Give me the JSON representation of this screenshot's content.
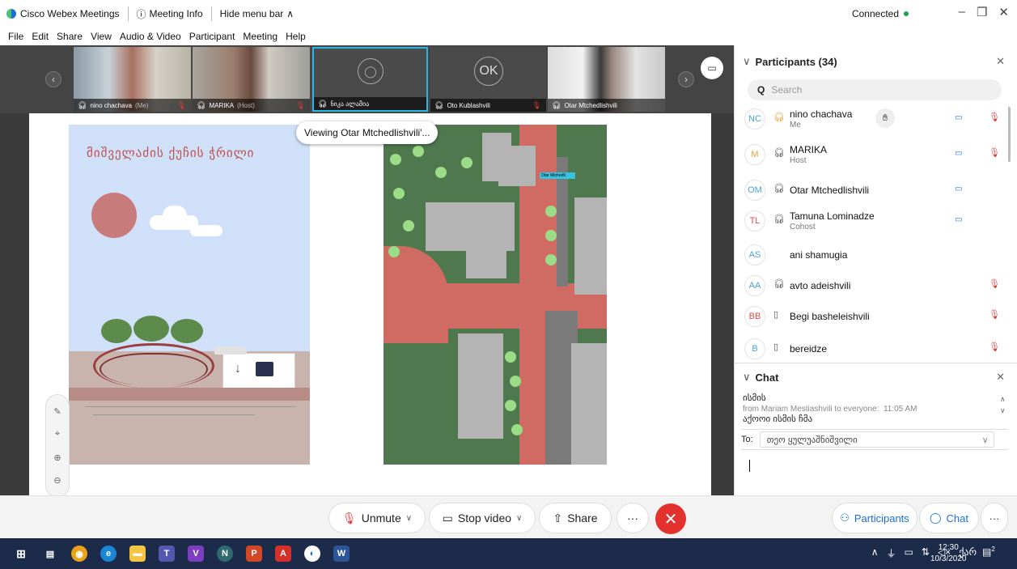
{
  "titlebar": {
    "app_name": "Cisco Webex Meetings",
    "meeting_info": "Meeting Info",
    "hide_menu": "Hide menu bar",
    "status": "Connected",
    "status_color": "#1aa351"
  },
  "menu": [
    "File",
    "Edit",
    "Share",
    "View",
    "Audio & Video",
    "Participant",
    "Meeting",
    "Help"
  ],
  "thumbnails": [
    {
      "name": "nino chachava",
      "tag": "(Me)",
      "muted": true
    },
    {
      "name": "MARIKA",
      "tag": "(Host)",
      "muted": true
    },
    {
      "name": "ნიკა ალამია",
      "tag": "",
      "muted": false
    },
    {
      "name": "Oto Kublashvili",
      "tag": "",
      "muted": true,
      "initials": "OK"
    },
    {
      "name": "Otar Mtchedlishvili",
      "tag": "",
      "muted": false
    }
  ],
  "viewing_label": "Viewing Otar Mtchedlishvili'...",
  "poster_title": "მიშველაძის ქუჩის ჭრილი",
  "map_tag": "Otar Mtchedli",
  "controls": {
    "unmute": "Unmute",
    "stop_video": "Stop video",
    "share": "Share",
    "more": "···",
    "participants": "Participants",
    "chat": "Chat"
  },
  "participants_panel": {
    "title": "Participants (34)",
    "search_placeholder": "Search",
    "list": [
      {
        "initials": "NC",
        "name": "nino chachava",
        "sub": "Me",
        "initials_color": "#4aa3d8",
        "video": true,
        "muted": true
      },
      {
        "initials": "M",
        "name": "MARIKA",
        "sub": "Host",
        "initials_color": "#e9a13b",
        "video": true,
        "muted": true
      },
      {
        "initials": "OM",
        "name": "Otar Mtchedlishvili",
        "sub": "",
        "initials_color": "#4aa3d8",
        "video": true,
        "muted": false
      },
      {
        "initials": "TL",
        "name": "Tamuna Lominadze",
        "sub": "Cohost",
        "initials_color": "#e24b4b",
        "video": true,
        "muted": false
      },
      {
        "initials": "AS",
        "name": "ani shamugia",
        "sub": "",
        "initials_color": "#4aa3d8",
        "video": false,
        "muted": false
      },
      {
        "initials": "AA",
        "name": "avto adeishvili",
        "sub": "",
        "initials_color": "#4aa3d8",
        "video": false,
        "muted": true
      },
      {
        "initials": "BB",
        "name": "Begi basheleishvili",
        "sub": "",
        "initials_color": "#e24b4b",
        "video": false,
        "muted": true
      },
      {
        "initials": "B",
        "name": "bereidze",
        "sub": "",
        "initials_color": "#4aa3d8",
        "video": false,
        "muted": true
      }
    ]
  },
  "chat_panel": {
    "title": "Chat",
    "message_top": "ისმის",
    "message_meta": "from Mariam Mestiashvili to everyone:",
    "message_time": "11:05 AM",
    "message_bottom": "აქოოი ისმის ჩმა",
    "to_label": "To:",
    "to_value": "თეო ყულუაშნიშვილი"
  },
  "taskbar": {
    "time": "12:30",
    "date": "10/3/2020",
    "lang": "ქარ",
    "notifications": "2"
  }
}
